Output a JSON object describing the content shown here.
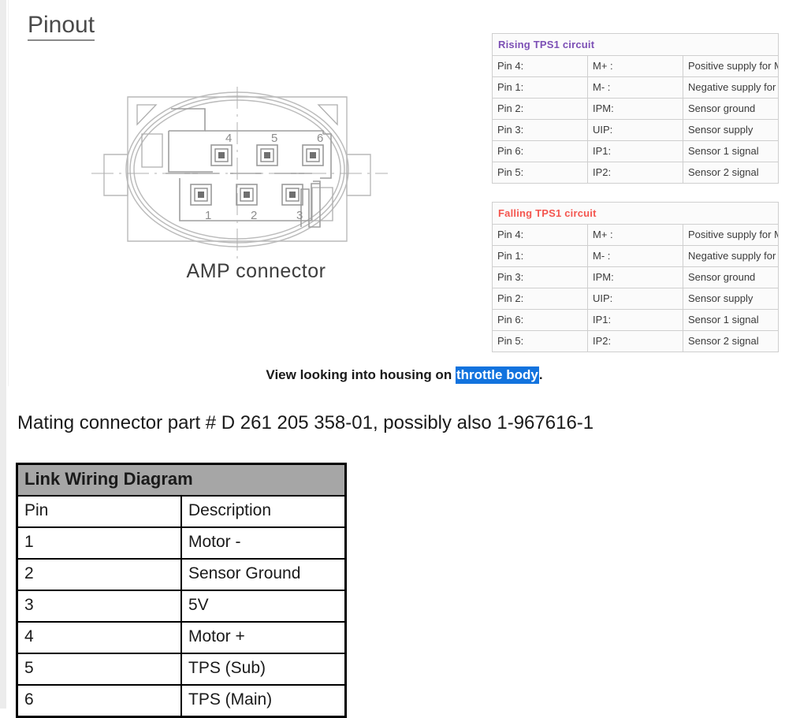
{
  "page": {
    "heading": "Pinout"
  },
  "connector": {
    "caption": "AMP connector",
    "pin_labels_top": [
      "4",
      "5",
      "6"
    ],
    "pin_labels_bottom": [
      "1",
      "2",
      "3"
    ],
    "outline_color": "#b5b5b5",
    "detail_color": "#8f8f8f"
  },
  "tps_tables": [
    {
      "id": "rising",
      "title": "Rising TPS1 circuit",
      "title_color": "#7c4fb5",
      "rows": [
        {
          "pin": "Pin 4:",
          "signal": "M+ :",
          "description": "Positive supply for Motor"
        },
        {
          "pin": "Pin 1:",
          "signal": "M- :",
          "description": "Negative supply for Motor"
        },
        {
          "pin": "Pin 2:",
          "signal": "IPM:",
          "description": "Sensor ground"
        },
        {
          "pin": "Pin 3:",
          "signal": "UIP:",
          "description": "Sensor supply"
        },
        {
          "pin": "Pin 6:",
          "signal": "IP1:",
          "description": "Sensor 1 signal"
        },
        {
          "pin": "Pin 5:",
          "signal": "IP2:",
          "description": "Sensor 2 signal"
        }
      ]
    },
    {
      "id": "falling",
      "title": "Falling TPS1 circuit",
      "title_color": "#f4564f",
      "rows": [
        {
          "pin": "Pin 4:",
          "signal": "M+ :",
          "description": "Positive supply for Motor"
        },
        {
          "pin": "Pin 1:",
          "signal": "M- :",
          "description": "Negative supply for Motor"
        },
        {
          "pin": "Pin 3:",
          "signal": "IPM:",
          "description": "Sensor ground"
        },
        {
          "pin": "Pin 2:",
          "signal": "UIP:",
          "description": "Sensor supply"
        },
        {
          "pin": "Pin 6:",
          "signal": "IP1:",
          "description": "Sensor 1 signal"
        },
        {
          "pin": "Pin 5:",
          "signal": "IP2:",
          "description": "Sensor 2 signal"
        }
      ]
    }
  ],
  "view_note": {
    "prefix": "View looking into housing on ",
    "highlight": "throttle body",
    "suffix": ".",
    "highlight_bg": "#1273de",
    "highlight_fg": "#ffffff"
  },
  "mating_connector": {
    "text": "Mating connector part # D 261 205 358-01, possibly also 1-967616-1"
  },
  "wiring_table": {
    "title": "Link Wiring Diagram",
    "title_bg": "#a6a6a6",
    "columns": [
      "Pin",
      "Description"
    ],
    "rows": [
      {
        "pin": "1",
        "description": "Motor -"
      },
      {
        "pin": "2",
        "description": "Sensor Ground"
      },
      {
        "pin": "3",
        "description": "5V"
      },
      {
        "pin": "4",
        "description": "Motor +"
      },
      {
        "pin": "5",
        "description": "TPS (Sub)"
      },
      {
        "pin": "6",
        "description": "TPS (Main)"
      }
    ]
  }
}
